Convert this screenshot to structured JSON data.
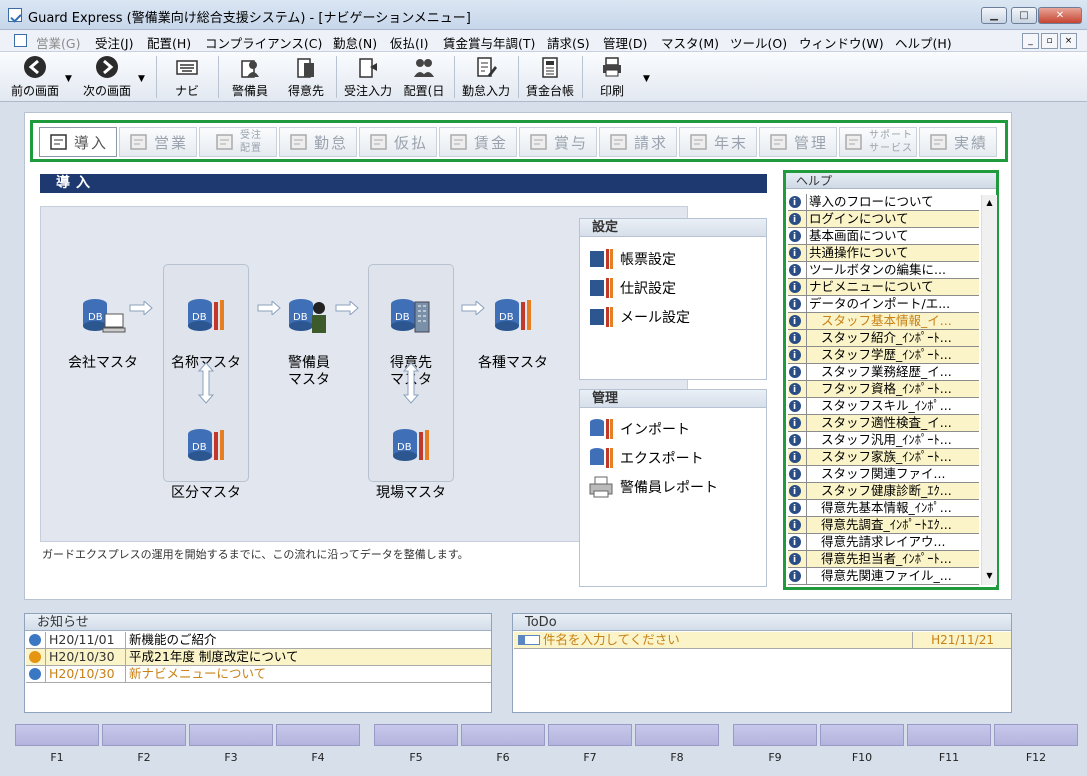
{
  "window": {
    "title": "Guard Express (警備業向け総合支援システム) - [ナビゲーションメニュー]",
    "min": "▁",
    "max": "□",
    "close": "✕"
  },
  "menu": {
    "items": [
      "営業(G)",
      "受注(J)",
      "配置(H)",
      "コンプライアンス(C)",
      "勤怠(N)",
      "仮払(I)",
      "賃金賞与年調(T)",
      "請求(S)",
      "管理(D)",
      "マスタ(M)",
      "ツール(O)",
      "ウィンドウ(W)",
      "ヘルプ(H)"
    ],
    "mdi": [
      "_",
      "▫",
      "×"
    ]
  },
  "toolbar": {
    "back": "前の画面",
    "forward": "次の画面",
    "navi": "ナビ",
    "guard": "警備員",
    "client": "得意先",
    "order_input": "受注入力",
    "placement": "配置(日",
    "attendance_input": "勤怠入力",
    "wage_ledger": "賃金台帳",
    "print": "印刷",
    "dropdown": "▼"
  },
  "tabs": [
    {
      "label": "導入",
      "active": true
    },
    {
      "label": "営業"
    },
    {
      "label": "受注\n配置",
      "small": true
    },
    {
      "label": "勤怠"
    },
    {
      "label": "仮払"
    },
    {
      "label": "賃金"
    },
    {
      "label": "賞与"
    },
    {
      "label": "請求"
    },
    {
      "label": "年末"
    },
    {
      "label": "管理"
    },
    {
      "label": "サポート\nサービス",
      "small": true
    },
    {
      "label": "実績"
    }
  ],
  "section": {
    "title": "導入"
  },
  "flow": {
    "db_text": "DB",
    "company": "会社マスタ",
    "name": "名称マスタ",
    "category": "区分マスタ",
    "guard": "警備員\nマスタ",
    "client": "得意先\nマスタ",
    "site": "現場マスタ",
    "various": "各種マスタ",
    "note": "ガードエクスプレスの運用を開始するまでに、この流れに沿ってデータを整備します。"
  },
  "settings": {
    "title": "設定",
    "items": [
      "帳票設定",
      "仕訳設定",
      "メール設定"
    ]
  },
  "manage": {
    "title": "管理",
    "items": [
      "インポート",
      "エクスポート",
      "警備員レポート"
    ]
  },
  "help": {
    "title": "ヘルプ",
    "items": [
      {
        "text": "導入のフローについて",
        "alt": false
      },
      {
        "text": "ログインについて",
        "alt": true
      },
      {
        "text": "基本画面について",
        "alt": false
      },
      {
        "text": "共通操作について",
        "alt": true
      },
      {
        "text": "ツールボタンの編集に...",
        "alt": false
      },
      {
        "text": "ナビメニューについて",
        "alt": true
      },
      {
        "text": "データのインポート/エ...",
        "alt": false
      },
      {
        "text": "スタッフ基本情報_イ...",
        "alt": true,
        "sub": true,
        "orange": true
      },
      {
        "text": "スタッフ紹介_ｲﾝﾎﾟｰﾄ...",
        "alt": true,
        "sub": true
      },
      {
        "text": "スタッフ学歴_ｲﾝﾎﾟｰﾄ...",
        "alt": true,
        "sub": true
      },
      {
        "text": "スタッフ業務経歴_イ...",
        "alt": false,
        "sub": true
      },
      {
        "text": "フタッフ資格_ｲﾝﾎﾟｰﾄ...",
        "alt": true,
        "sub": true
      },
      {
        "text": "スタッフスキル_ｲﾝﾎﾟ...",
        "alt": false,
        "sub": true
      },
      {
        "text": "スタッフ適性検査_イ...",
        "alt": true,
        "sub": true
      },
      {
        "text": "スタッフ汎用_ｲﾝﾎﾟｰﾄ...",
        "alt": false,
        "sub": true
      },
      {
        "text": "スタッフ家族_ｲﾝﾎﾟｰﾄ...",
        "alt": true,
        "sub": true
      },
      {
        "text": "スタッフ関連ファイ...",
        "alt": false,
        "sub": true
      },
      {
        "text": "スタッフ健康診断_ｴｸ...",
        "alt": true,
        "sub": true
      },
      {
        "text": "得意先基本情報_ｲﾝﾎﾟ...",
        "alt": false,
        "sub": true
      },
      {
        "text": "得意先調査_ｲﾝﾎﾟｰﾄｴｸ...",
        "alt": true,
        "sub": true
      },
      {
        "text": "得意先請求レイアウ...",
        "alt": false,
        "sub": true
      },
      {
        "text": "得意先担当者_ｲﾝﾎﾟｰﾄ...",
        "alt": true,
        "sub": true
      },
      {
        "text": "得意先関連ファイル_...",
        "alt": false,
        "sub": true
      }
    ],
    "scroll_up": "▲",
    "scroll_down": "▼"
  },
  "notice": {
    "title": "お知らせ",
    "rows": [
      {
        "date": "H20/11/01",
        "text": "新機能のご紹介",
        "alt": false,
        "icon": "blue"
      },
      {
        "date": "H20/10/30",
        "text": "平成21年度 制度改定について",
        "alt": true,
        "icon": "orange"
      },
      {
        "date": "H20/10/30",
        "text": "新ナビメニューについて",
        "alt": false,
        "icon": "blue",
        "orange": true
      }
    ]
  },
  "todo": {
    "title": "ToDo",
    "placeholder": "件名を入力してください",
    "date": "H21/11/21"
  },
  "fkeys": [
    "F1",
    "F2",
    "F3",
    "F4",
    "F5",
    "F6",
    "F7",
    "F8",
    "F9",
    "F10",
    "F11",
    "F12"
  ],
  "colors": {
    "highlight_border": "#1f9a3c",
    "section_header": "#1d3970",
    "row_alt": "#fbf4c8",
    "orange_text": "#c78116"
  }
}
